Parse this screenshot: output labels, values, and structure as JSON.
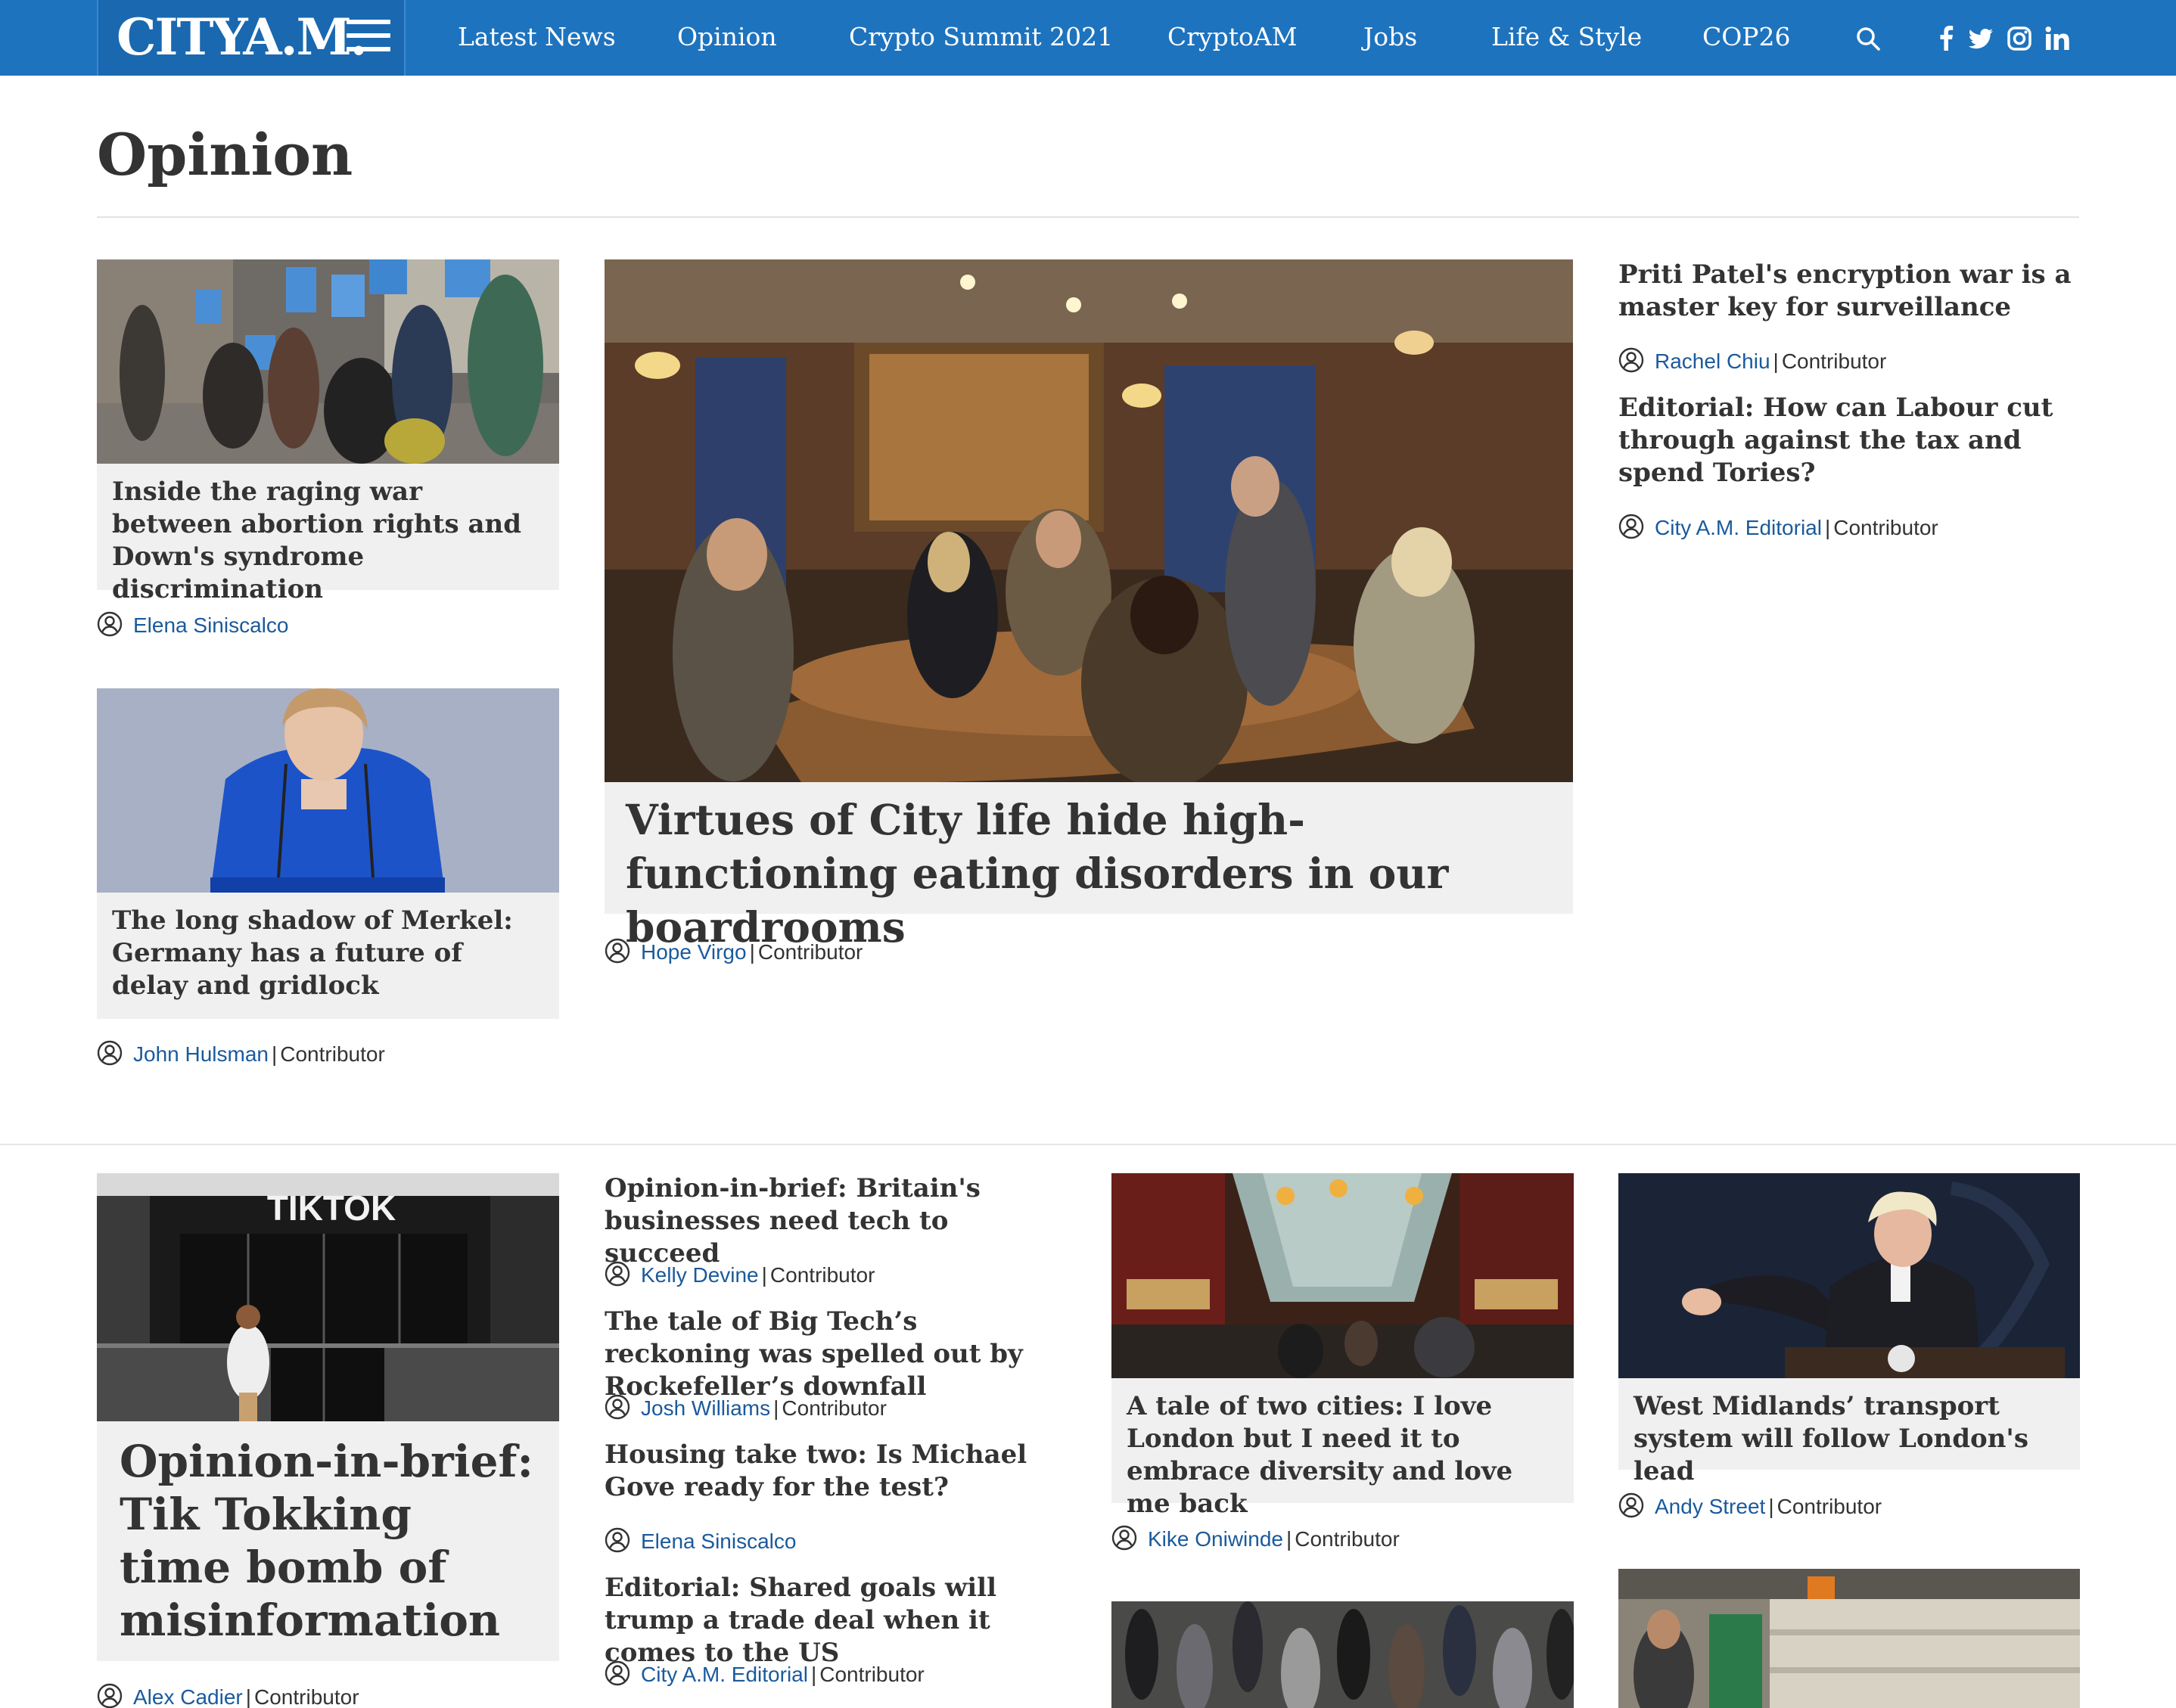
{
  "header": {
    "logo": "CITYA.M.",
    "nav": [
      "Latest News",
      "Opinion",
      "Crypto Summit 2021",
      "CryptoAM",
      "Jobs",
      "Life & Style",
      "COP26"
    ],
    "icons": [
      "search-icon",
      "facebook-icon",
      "twitter-icon",
      "instagram-icon",
      "linkedin-icon"
    ],
    "bar_color": "#1e73be"
  },
  "page": {
    "title": "Opinion"
  },
  "articles": {
    "a1": {
      "headline": "Inside the raging war between abortion rights and Down's syndrome discrimination",
      "author": "Elena Siniscalco",
      "role": ""
    },
    "a2": {
      "headline": "The long shadow of Merkel: Germany has a future of delay and gridlock",
      "author": "John Hulsman",
      "role": "Contributor"
    },
    "feature": {
      "headline": "Virtues of City life hide high-functioning eating disorders in our boardrooms",
      "author": "Hope Virgo",
      "role": "Contributor"
    },
    "r1": {
      "headline": "Priti Patel's encryption war is a master key for surveillance",
      "author": "Rachel Chiu",
      "role": "Contributor"
    },
    "r2": {
      "headline": "Editorial: How can Labour cut through against the tax and spend Tories?",
      "author": "City A.M. Editorial",
      "role": "Contributor"
    },
    "b1": {
      "headline": "Opinion-in-brief: Tik Tokking time bomb of misinformation",
      "author": "Alex Cadier",
      "role": "Contributor",
      "image_sign": "TIKTOK"
    },
    "b2": {
      "headline": "Opinion-in-brief: Britain's businesses need tech to succeed",
      "author": "Kelly Devine",
      "role": "Contributor"
    },
    "b3": {
      "headline": "The tale of Big Tech’s reckoning was spelled out by Rockefeller’s downfall",
      "author": "Josh Williams",
      "role": "Contributor"
    },
    "b4": {
      "headline": "Housing take two: Is Michael Gove ready for the test?",
      "author": "Elena Siniscalco",
      "role": ""
    },
    "b5": {
      "headline": "Editorial: Shared goals will trump a trade deal when it comes to the US",
      "author": "City A.M. Editorial",
      "role": "Contributor"
    },
    "c1": {
      "headline": "A tale of two cities: I love London but I need it to embrace diversity and love me back",
      "author": "Kike Oniwinde",
      "role": "Contributor"
    },
    "d1": {
      "headline": "West Midlands’ transport system will follow London's lead",
      "author": "Andy Street",
      "role": "Contributor"
    }
  },
  "colors": {
    "link": "#1a5a9c",
    "headline_bg": "#f0f0f0",
    "text": "#333333"
  }
}
